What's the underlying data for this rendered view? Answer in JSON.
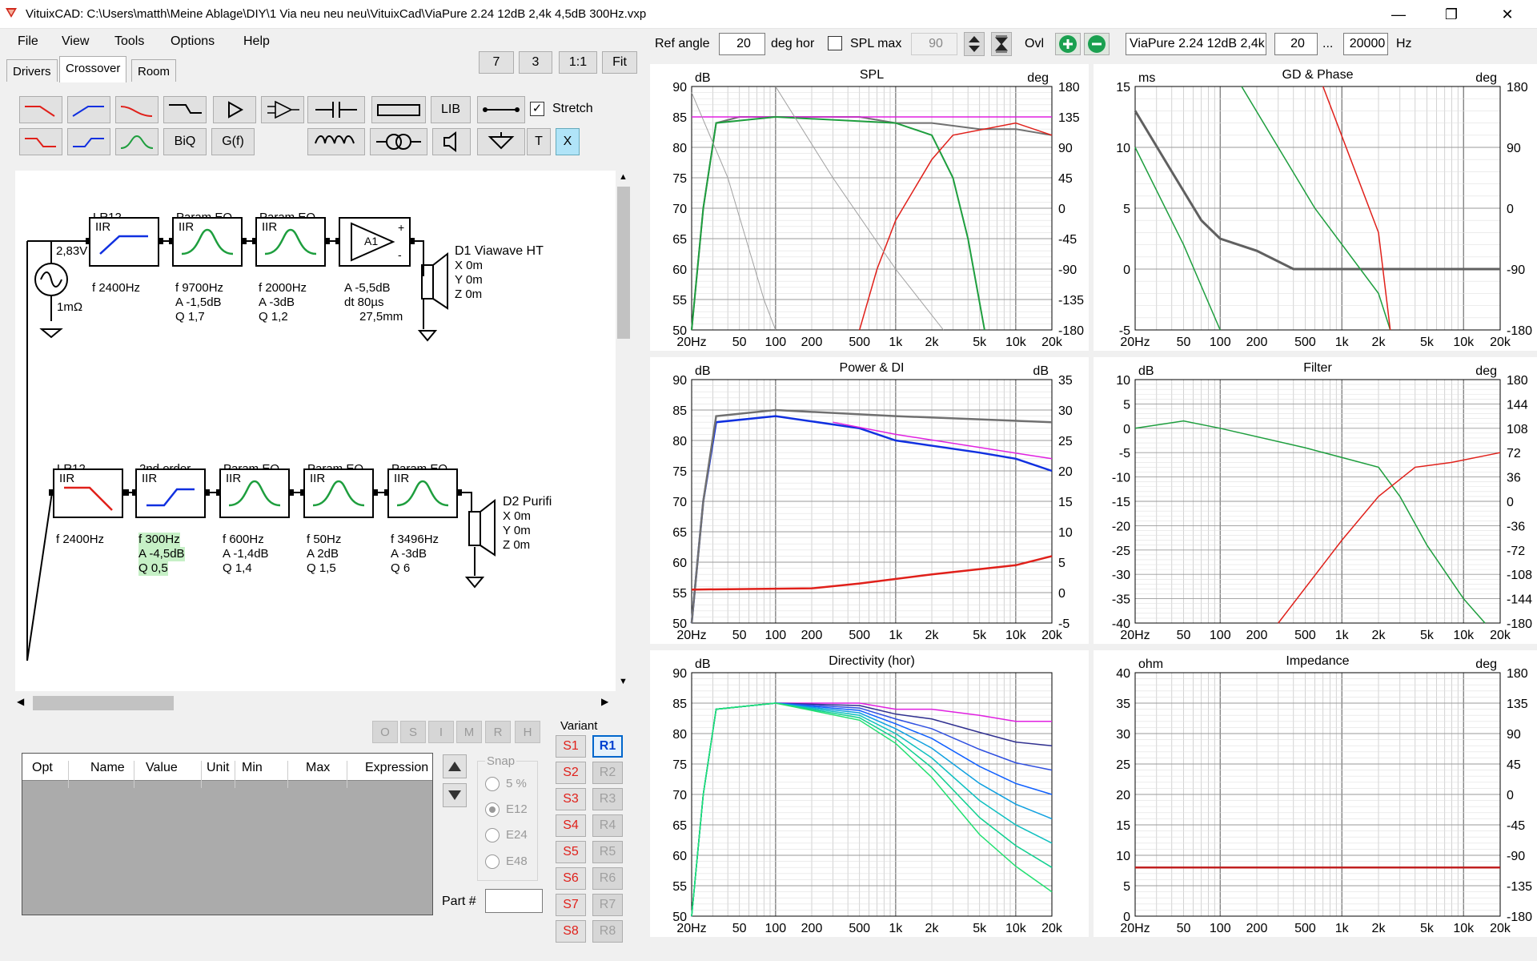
{
  "window": {
    "title": "VituixCAD: C:\\Users\\matth\\Meine Ablage\\DIY\\1 Via neu neu neu\\VituixCad\\ViaPure 2.24 12dB 2,4k 4,5dB 300Hz.vxp"
  },
  "menu": [
    "File",
    "View",
    "Tools",
    "Options",
    "Help"
  ],
  "tabs": [
    "Drivers",
    "Crossover",
    "Room"
  ],
  "view_buttons": [
    "7",
    "3",
    "1:1",
    "Fit"
  ],
  "toolbar": {
    "lib": "LIB",
    "biq": "BiQ",
    "gf": "G(f)",
    "t": "T",
    "x": "X",
    "stretch_label": "Stretch",
    "stretch_checked": true
  },
  "schematic": {
    "row1": {
      "source_voltage": "2,83V",
      "source_resistance": "1mΩ",
      "blocks": [
        {
          "name": "LR12",
          "kind": "IIR",
          "p1": "f   2400Hz",
          "p2": "",
          "p3": ""
        },
        {
          "name": "Param EQ",
          "kind": "IIR",
          "p1": "f   9700Hz",
          "p2": "A  -1,5dB",
          "p3": "Q  1,7"
        },
        {
          "name": "Param EQ",
          "kind": "IIR",
          "p1": "f   2000Hz",
          "p2": "A  -3dB",
          "p3": "Q  1,2"
        }
      ],
      "amp": {
        "label": "A1",
        "p1": "A  -5,5dB",
        "p2": "dt 80µs",
        "p3": "27,5mm"
      },
      "driver": {
        "name": "D1 Viawave HT",
        "x": "X 0m",
        "y": "Y 0m",
        "z": "Z 0m"
      }
    },
    "row2": {
      "blocks": [
        {
          "name": "LR12",
          "kind": "IIR",
          "p1": "f   2400Hz",
          "p2": "",
          "p3": ""
        },
        {
          "name": "2nd order",
          "kind": "IIR",
          "p1": "f  300Hz",
          "p2": "A  -4,5dB",
          "p3": "Q  0,5"
        },
        {
          "name": "Param EQ",
          "kind": "IIR",
          "p1": "f   600Hz",
          "p2": "A  -1,4dB",
          "p3": "Q  1,4"
        },
        {
          "name": "Param EQ",
          "kind": "IIR",
          "p1": "f   50Hz",
          "p2": "A  2dB",
          "p3": "Q  1,5"
        },
        {
          "name": "Param EQ",
          "kind": "IIR",
          "p1": "f   3496Hz",
          "p2": "A  -3dB",
          "p3": "Q  6"
        }
      ],
      "driver": {
        "name": "D2 Purifi",
        "x": "X 0m",
        "y": "Y 0m",
        "z": "Z 0m"
      }
    }
  },
  "opt_buttons": [
    "O",
    "S",
    "I",
    "M",
    "R",
    "H"
  ],
  "table": {
    "columns": [
      "Opt",
      "Name",
      "Value",
      "Unit",
      "Min",
      "Max",
      "Expression"
    ]
  },
  "snap": {
    "title": "Snap",
    "options": [
      "5 %",
      "E12",
      "E24",
      "E48"
    ],
    "selected": "E12"
  },
  "part_label": "Part #",
  "variant": {
    "title": "Variant",
    "s": [
      "S1",
      "S2",
      "S3",
      "S4",
      "S5",
      "S6",
      "S7",
      "S8"
    ],
    "r": [
      "R1",
      "R2",
      "R3",
      "R4",
      "R5",
      "R6",
      "R7",
      "R8"
    ],
    "active": "R1"
  },
  "topbar": {
    "ref_angle_label": "Ref angle",
    "ref_angle": "20",
    "deg_hor": "deg hor",
    "spl_max_label": "SPL max",
    "spl_max": "90",
    "ovl": "Ovl",
    "name": "ViaPure 2.24 12dB 2,4k",
    "f_min": "20",
    "dots": "...",
    "f_max": "20000",
    "hz": "Hz"
  },
  "colors": {
    "accent_green": "#1e9e3e",
    "driver_red": "#e0201a",
    "grid": "#b4b4b4"
  },
  "charts": [
    {
      "title": "SPL",
      "left_unit": "dB",
      "right_unit": "deg",
      "left_ticks": [
        "90",
        "85",
        "80",
        "75",
        "70",
        "65",
        "60",
        "55",
        "50"
      ],
      "right_ticks": [
        "180",
        "135",
        "90",
        "45",
        "0",
        "-45",
        "-90",
        "-135",
        "-180"
      ],
      "x_ticks": [
        "20Hz",
        "50",
        "100",
        "200",
        "500",
        "1k",
        "2k",
        "5k",
        "10k",
        "20k"
      ]
    },
    {
      "title": "GD & Phase",
      "left_unit": "ms",
      "right_unit": "deg",
      "left_ticks": [
        "15",
        "10",
        "5",
        "0",
        "-5"
      ],
      "right_ticks": [
        "180",
        "90",
        "0",
        "-90",
        "-180"
      ],
      "x_ticks": [
        "20Hz",
        "50",
        "100",
        "200",
        "500",
        "1k",
        "2k",
        "5k",
        "10k",
        "20k"
      ]
    },
    {
      "title": "Power & DI",
      "left_unit": "dB",
      "right_unit": "dB",
      "left_ticks": [
        "90",
        "85",
        "80",
        "75",
        "70",
        "65",
        "60",
        "55",
        "50"
      ],
      "right_ticks": [
        "35",
        "30",
        "25",
        "20",
        "15",
        "10",
        "5",
        "0",
        "-5"
      ],
      "x_ticks": [
        "20Hz",
        "50",
        "100",
        "200",
        "500",
        "1k",
        "2k",
        "5k",
        "10k",
        "20k"
      ]
    },
    {
      "title": "Filter",
      "left_unit": "dB",
      "right_unit": "deg",
      "left_ticks": [
        "10",
        "5",
        "0",
        "-5",
        "-10",
        "-15",
        "-20",
        "-25",
        "-30",
        "-35",
        "-40"
      ],
      "right_ticks": [
        "180",
        "144",
        "108",
        "72",
        "36",
        "0",
        "-36",
        "-72",
        "-108",
        "-144",
        "-180"
      ],
      "x_ticks": [
        "20Hz",
        "50",
        "100",
        "200",
        "500",
        "1k",
        "2k",
        "5k",
        "10k",
        "20k"
      ]
    },
    {
      "title": "Directivity (hor)",
      "left_unit": "dB",
      "right_unit": "",
      "left_ticks": [
        "90",
        "85",
        "80",
        "75",
        "70",
        "65",
        "60",
        "55",
        "50"
      ],
      "right_ticks": [],
      "x_ticks": [
        "20Hz",
        "50",
        "100",
        "200",
        "500",
        "1k",
        "2k",
        "5k",
        "10k",
        "20k"
      ]
    },
    {
      "title": "Impedance",
      "left_unit": "ohm",
      "right_unit": "deg",
      "left_ticks": [
        "40",
        "35",
        "30",
        "25",
        "20",
        "15",
        "10",
        "5",
        "0"
      ],
      "right_ticks": [
        "180",
        "135",
        "90",
        "45",
        "0",
        "-45",
        "-90",
        "-135",
        "-180"
      ],
      "x_ticks": [
        "20Hz",
        "50",
        "100",
        "200",
        "500",
        "1k",
        "2k",
        "5k",
        "10k",
        "20k"
      ]
    }
  ]
}
